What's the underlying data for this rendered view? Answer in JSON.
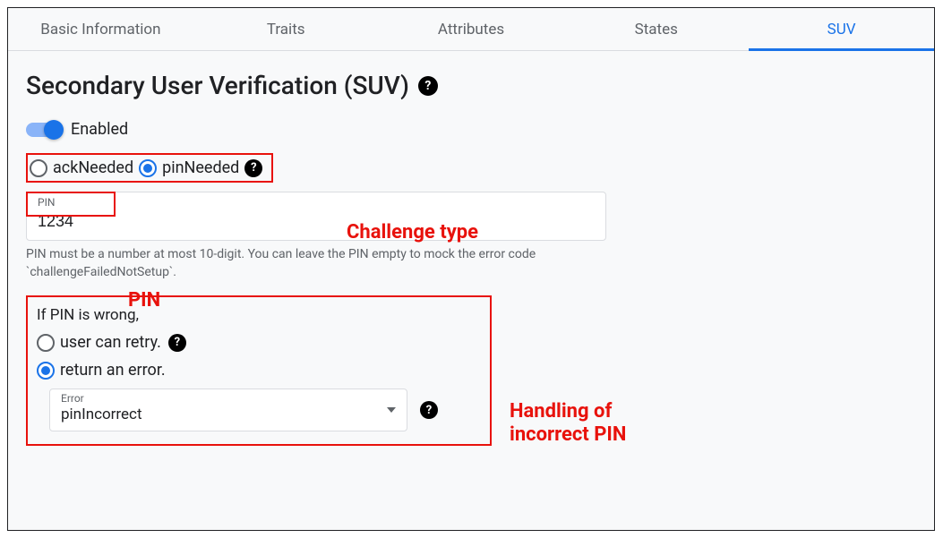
{
  "tabs": {
    "basic": "Basic Information",
    "traits": "Traits",
    "attributes": "Attributes",
    "states": "States",
    "suv": "SUV"
  },
  "page": {
    "title": "Secondary User Verification (SUV)"
  },
  "toggle": {
    "label": "Enabled",
    "state": true
  },
  "challenge": {
    "ack_label": "ackNeeded",
    "pin_label": "pinNeeded",
    "selected": "pinNeeded"
  },
  "pin_field": {
    "float_label": "PIN",
    "value": "1234",
    "helper": "PIN must be a number at most 10-digit. You can leave the PIN empty to mock the error code `challengeFailedNotSetup`."
  },
  "wrong_pin": {
    "prompt": "If PIN is wrong,",
    "retry_label": "user can retry.",
    "error_label": "return an error.",
    "selected": "error",
    "error_select": {
      "float_label": "Error",
      "value": "pinIncorrect"
    }
  },
  "annotations": {
    "challenge": "Challenge type",
    "pin": "PIN",
    "handling": "Handling of incorrect PIN"
  }
}
